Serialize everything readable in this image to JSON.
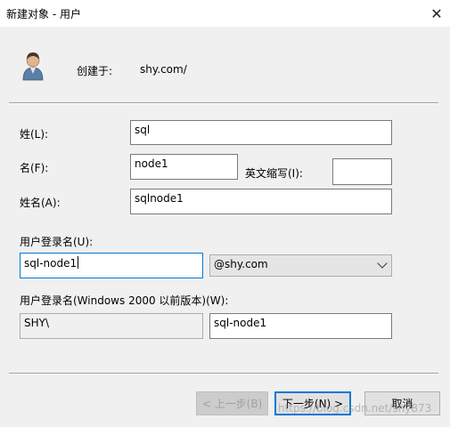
{
  "window": {
    "title": "新建对象 - 用户",
    "close_symbol": "✕"
  },
  "header": {
    "create_in_label": "创建于:",
    "create_in_value": "shy.com/"
  },
  "form": {
    "last_name_label": "姓(L):",
    "last_name_value": "sql",
    "first_name_label": "名(F):",
    "first_name_value": "node1",
    "initials_label": "英文缩写(I):",
    "initials_value": "",
    "full_name_label": "姓名(A):",
    "full_name_value": "sqlnode1",
    "logon_label": "用户登录名(U):",
    "logon_value": "sql-node1",
    "domain_select": "@shy.com",
    "pre2000_label": "用户登录名(Windows 2000 以前版本)(W):",
    "pre2000_domain": "SHY\\",
    "pre2000_value": "sql-node1"
  },
  "buttons": {
    "back": "< 上一步(B)",
    "next": "下一步(N) >",
    "cancel": "取消"
  },
  "watermark": "https://blog.csdn.net/shy873"
}
